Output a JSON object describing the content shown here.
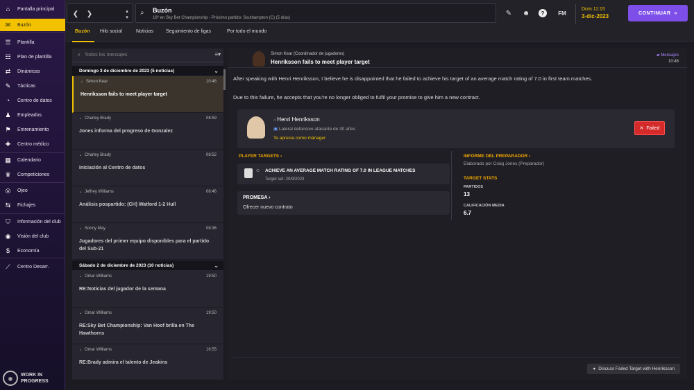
{
  "sidebar": {
    "items": [
      {
        "label": "Pantalla principal",
        "icon": "home-icon",
        "glyph": "⌂"
      },
      {
        "label": "Buzón",
        "icon": "inbox-icon",
        "glyph": "✉"
      },
      {
        "label": "Plantilla",
        "icon": "squad-icon",
        "glyph": "☰"
      },
      {
        "label": "Plan de plantilla",
        "icon": "squad-plan-icon",
        "glyph": "☷"
      },
      {
        "label": "Dinámicas",
        "icon": "dynamics-icon",
        "glyph": "⇄"
      },
      {
        "label": "Tácticas",
        "icon": "tactics-icon",
        "glyph": "✎"
      },
      {
        "label": "Centro de datos",
        "icon": "data-hub-icon",
        "glyph": "◔"
      },
      {
        "label": "Empleados",
        "icon": "staff-icon",
        "glyph": "♟"
      },
      {
        "label": "Entrenamiento",
        "icon": "training-icon",
        "glyph": "⚑"
      },
      {
        "label": "Centro médico",
        "icon": "medical-icon",
        "glyph": "✚"
      },
      {
        "label": "Calendario",
        "icon": "calendar-icon",
        "glyph": "▦"
      },
      {
        "label": "Competiciones",
        "icon": "trophy-icon",
        "glyph": "♛"
      },
      {
        "label": "Ojeo",
        "icon": "scouting-icon",
        "glyph": "◎"
      },
      {
        "label": "Fichajes",
        "icon": "transfers-icon",
        "glyph": "⇆"
      },
      {
        "label": "Información del club",
        "icon": "club-info-icon",
        "glyph": "⛉"
      },
      {
        "label": "Visión del club",
        "icon": "club-vision-icon",
        "glyph": "◉"
      },
      {
        "label": "Economía",
        "icon": "finances-icon",
        "glyph": "$"
      },
      {
        "label": "Centro Desarr.",
        "icon": "dev-centre-icon",
        "glyph": "⟋"
      }
    ],
    "wip": "WORK IN PROGRESS"
  },
  "topbar": {
    "title": "Buzón",
    "subtitle": "16º en Sky Bet Championship - Próximo partido: Southampton (C) (5 días)",
    "date_line1": "Dom 11:15",
    "date_line2": "3-dic-2023",
    "continue": "CONTINUAR",
    "fm": "FM"
  },
  "tabs": [
    "Buzón",
    "Hilo social",
    "Noticias",
    "Seguimiento de ligas",
    "Por todo el mundo"
  ],
  "list": {
    "search_placeholder": "Todos los mensajes",
    "group1": "Domingo 3 de diciembre de 2023 (5 noticias)",
    "group2": "Sábado 2 de diciembre de 2023 (10 noticias)",
    "messages": [
      {
        "from": "Simon Kear",
        "time": "10:46",
        "subject": "Henriksson fails to meet player target"
      },
      {
        "from": "Charley Brady",
        "time": "08:59",
        "subject": "Jones informa del progreso de Gonzalez"
      },
      {
        "from": "Charley Brady",
        "time": "08:52",
        "subject": "Iniciación al Centro de datos"
      },
      {
        "from": "Jeffrey Williams",
        "time": "08:46",
        "subject": "Análisis pospartido: (CH) Watford 1-2 Hull"
      },
      {
        "from": "Sonny May",
        "time": "08:36",
        "subject": "Jugadores del primer equipo disponibles para el partido del Sub-21"
      },
      {
        "from": "Omar Williams",
        "time": "19:50",
        "subject": "RE:Noticias del jugador de la semana"
      },
      {
        "from": "Omar Williams",
        "time": "19:50",
        "subject": "RE:Sky Bet Championship: Van Hoof brilla en The Hawthorns"
      },
      {
        "from": "Omar Williams",
        "time": "16:55",
        "subject": "RE:Brady admira el talento de Jeakins"
      }
    ]
  },
  "detail": {
    "from": "Simon Kear  (Coordinador de jugadores)",
    "subject": "Henriksson fails to meet player target",
    "tag": "Mensajes",
    "time": "10:46",
    "body1": "After speaking with Henri Henriksson, I believe he is disappointed that he failed to achieve his target of an average match rating of 7.0 in first team matches.",
    "body2": "Due to this failure, he accepts that you're no longer obliged to fulfil your promise to give him a new contract.",
    "player_name": "Henri Henriksson",
    "player_pos": "Lateral defensivo atacante de 30 años",
    "player_rel": "Te aprecia como mánager",
    "status": "Failed",
    "targets_title": "PLAYER TARGETS",
    "target": "ACHIEVE AN AVERAGE MATCH RATING OF 7.0 IN LEAGUE MATCHES",
    "target_set": "Target set: 20/9/2023",
    "promise_title": "PROMESA",
    "promise": "Ofrecer nuevo contrato",
    "coach_title": "INFORME DEL PREPARADOR",
    "coach_by": "Elaborado por Craig Jones (Preparador)",
    "stats_title": "TARGET STATS",
    "stat1_l": "PARTIDOS",
    "stat1_v": "13",
    "stat2_l": "CALIFICACIÓN MEDIA",
    "stat2_v": "6.7",
    "discuss": "Discuss Failed Target with Henriksson"
  }
}
